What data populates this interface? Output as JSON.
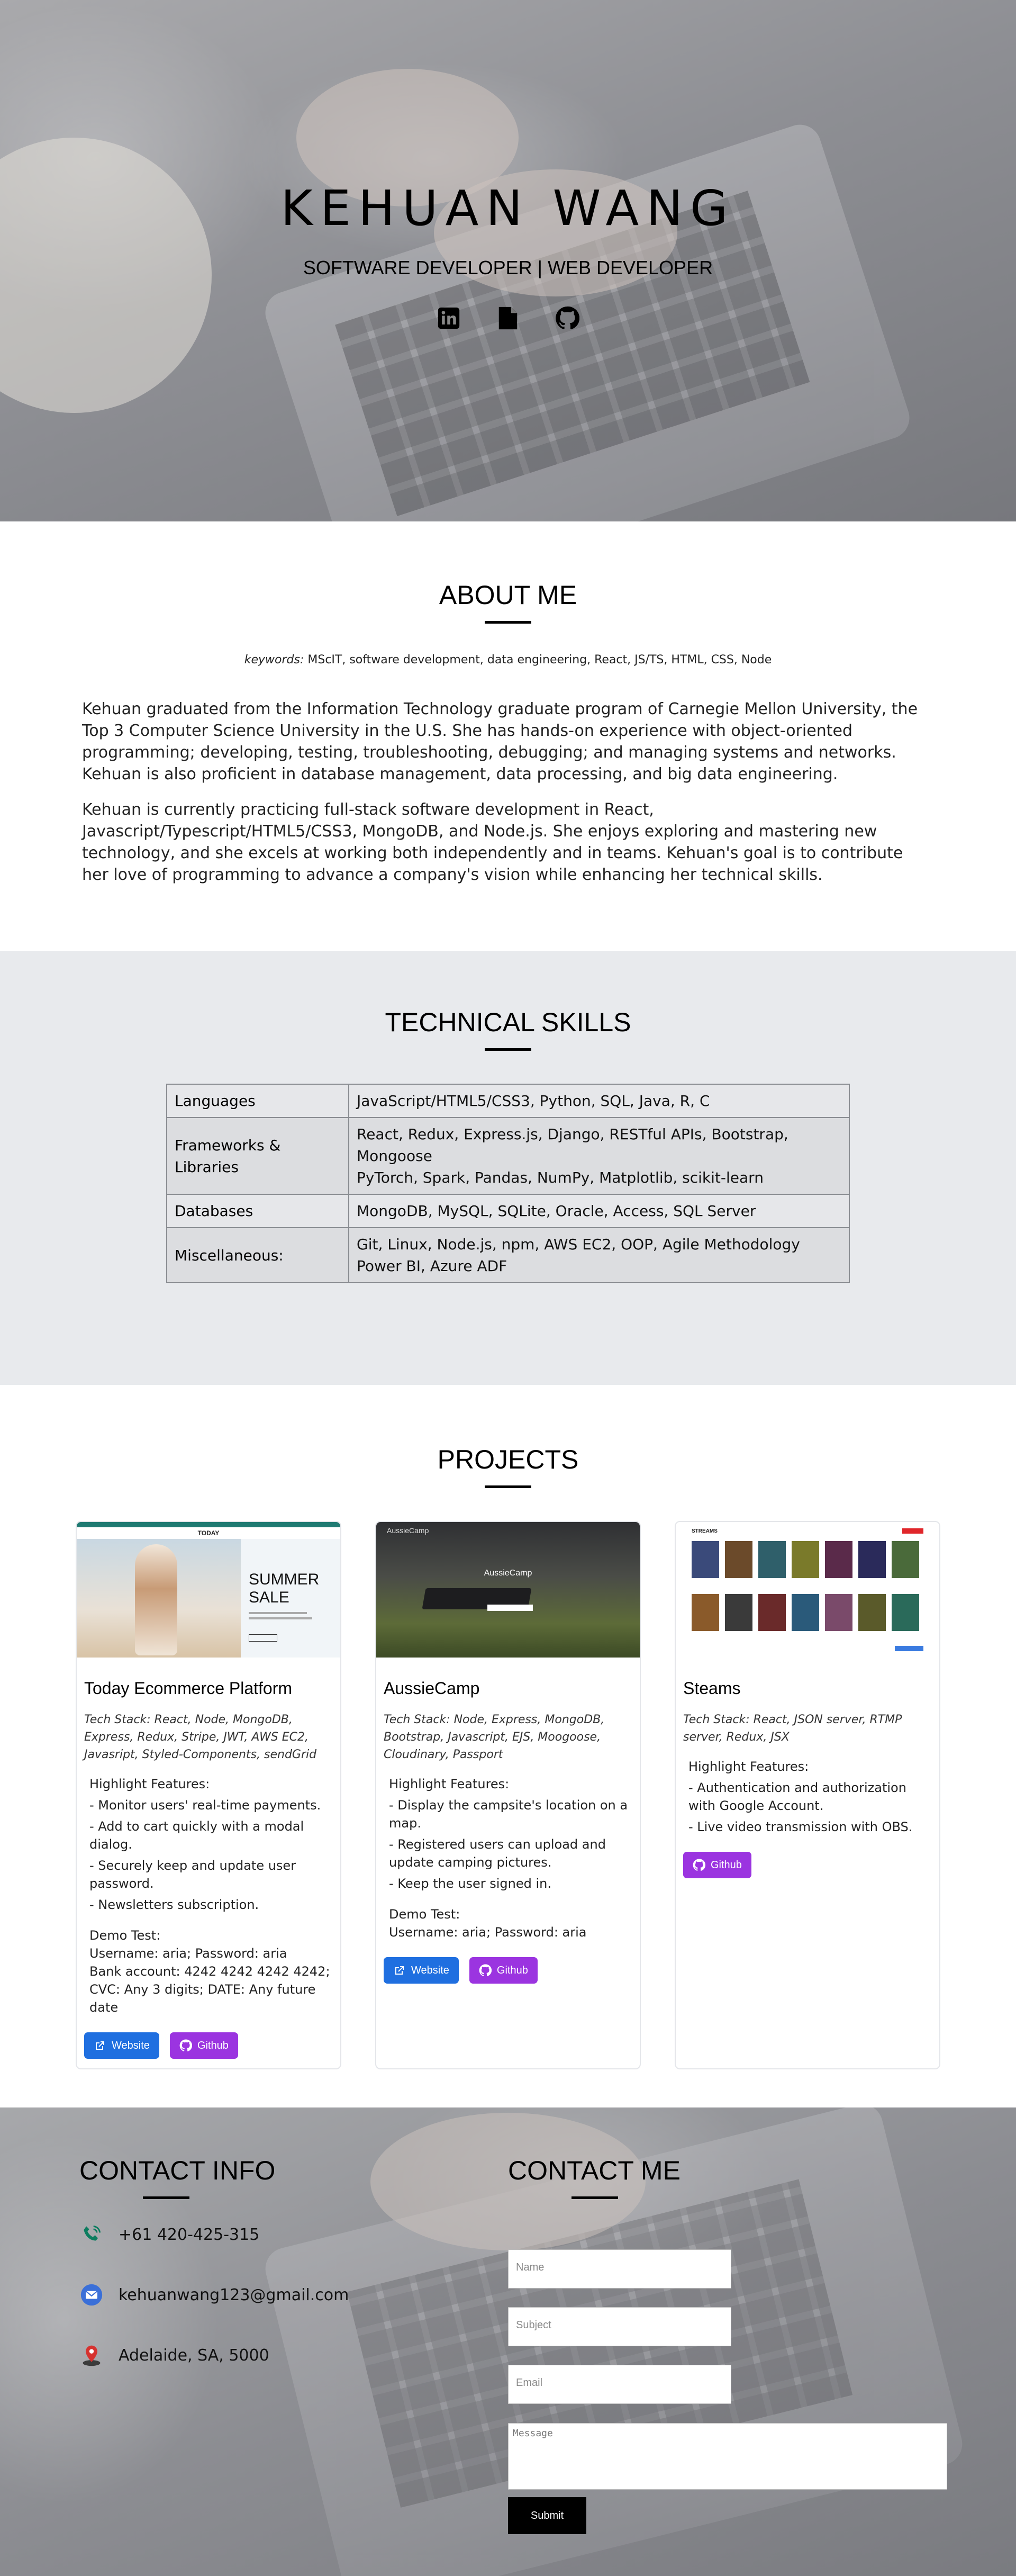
{
  "hero": {
    "name": "KEHUAN WANG",
    "subtitle": "SOFTWARE DEVELOPER | WEB DEVELOPER",
    "icons": [
      "linkedin-icon",
      "document-icon",
      "github-icon"
    ]
  },
  "about": {
    "title": "ABOUT ME",
    "keywords_label": "keywords:",
    "keywords": "MScIT, software development, data engineering, React, JS/TS, HTML, CSS, Node",
    "p1": "Kehuan graduated from the Information Technology graduate program of Carnegie Mellon University, the Top 3 Computer Science University in the U.S. She has hands-on experience with object-oriented programming; developing, testing, troubleshooting, debugging; and managing systems and networks. Kehuan is also proficient in database management, data processing, and big data engineering.",
    "p2": "Kehuan is currently practicing full-stack software development in React, Javascript/Typescript/HTML5/CSS3, MongoDB, and Node.js. She enjoys exploring and mastering new technology, and she excels at working both independently and in teams. Kehuan's goal is to contribute her love of programming to advance a company's vision while enhancing her technical skills."
  },
  "skills": {
    "title": "TECHNICAL SKILLS",
    "rows": [
      {
        "key": "Languages",
        "lines": [
          "JavaScript/HTML5/CSS3, Python, SQL, Java, R, C"
        ]
      },
      {
        "key": "Frameworks & Libraries",
        "lines": [
          "React, Redux, Express.js, Django, RESTful APIs, Bootstrap, Mongoose",
          "PyTorch, Spark, Pandas, NumPy, Matplotlib, scikit-learn"
        ]
      },
      {
        "key": "Databases",
        "lines": [
          "MongoDB, MySQL, SQLite, Oracle, Access, SQL Server"
        ]
      },
      {
        "key": "Miscellaneous:",
        "lines": [
          "Git, Linux, Node.js, npm, AWS EC2, OOP, Agile Methodology",
          "Power BI, Azure ADF"
        ]
      }
    ]
  },
  "projects": {
    "title": "PROJECTS",
    "items": [
      {
        "title": "Today Ecommerce Platform",
        "thumb_brand": "TODAY",
        "thumb_headline": "SUMMER SALE",
        "stack": "Tech Stack: React, Node, MongoDB, Express, Redux, Stripe, JWT, AWS EC2, Javasript, Styled-Components, sendGrid",
        "highlights_title": "Highlight Features:",
        "highlights": [
          "- Monitor users' real-time payments.",
          "- Add to cart quickly with a modal dialog.",
          "- Securely keep and update user password.",
          "- Newsletters subscription."
        ],
        "demo_title": "Demo Test:",
        "demo": [
          "Username: aria; Password: aria",
          "Bank account: 4242 4242 4242 4242; CVC: Any 3 digits; DATE: Any future date"
        ],
        "buttons": {
          "website": "Website",
          "github": "Github"
        }
      },
      {
        "title": "AussieCamp",
        "thumb_brand": "AussieCamp",
        "thumb_headline": "AussieCamp",
        "stack": "Tech Stack: Node, Express, MongoDB, Bootstrap, Javascript, EJS, Moogoose, Cloudinary, Passport",
        "highlights_title": "Highlight Features:",
        "highlights": [
          "- Display the campsite's location on a map.",
          "- Registered users can upload and update camping pictures.",
          "- Keep the user signed in."
        ],
        "demo_title": "Demo Test:",
        "demo": [
          "Username: aria; Password: aria"
        ],
        "buttons": {
          "website": "Website",
          "github": "Github"
        }
      },
      {
        "title": "Steams",
        "thumb_brand": "STREAMS",
        "stack": "Tech Stack: React, JSON server, RTMP server, Redux, JSX",
        "highlights_title": "Highlight Features:",
        "highlights": [
          "- Authentication and authorization with Google Account.",
          "- Live video transmission with OBS."
        ],
        "buttons": {
          "github": "Github"
        }
      }
    ]
  },
  "contact": {
    "info_title": "CONTACT INFO",
    "me_title": "CONTACT ME",
    "phone": "+61 420-425-315",
    "email": "kehuanwang123@gmail.com",
    "location": "Adelaide, SA, 5000",
    "form": {
      "name_placeholder": "Name",
      "subject_placeholder": "Subject",
      "email_placeholder": "Email",
      "message_placeholder": "Message",
      "submit": "Submit"
    }
  },
  "colors": {
    "accent_blue": "#1f6fe0",
    "accent_purple": "#9b34e0",
    "section_gray": "#e8eaed"
  }
}
